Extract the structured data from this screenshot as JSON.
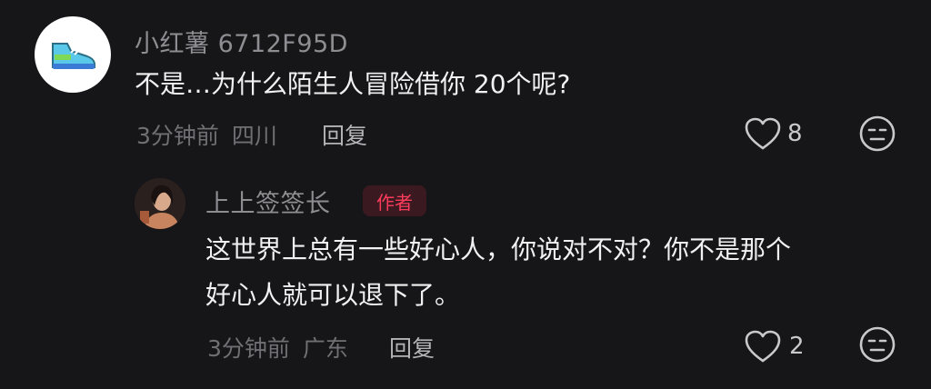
{
  "comment": {
    "avatar_icon": "sneaker-icon",
    "username": "小红薯 6712F95D",
    "text": "不是…为什么陌生人冒险借你 20个呢?",
    "time": "3分钟前",
    "location": "四川",
    "reply_label": "回复",
    "like_count": "8"
  },
  "reply": {
    "username": "上上签签长",
    "author_badge": "作者",
    "text_line1": "这世界上总有一些好心人，你说对不对？你不是那个",
    "text_line2": "好心人就可以退下了。",
    "time": "3分钟前",
    "location": "广东",
    "reply_label": "回复",
    "like_count": "2"
  },
  "colors": {
    "background": "#161619",
    "author_badge": "#ff3b5c",
    "text": "#f1f1f1",
    "muted": "#6f6f74"
  }
}
